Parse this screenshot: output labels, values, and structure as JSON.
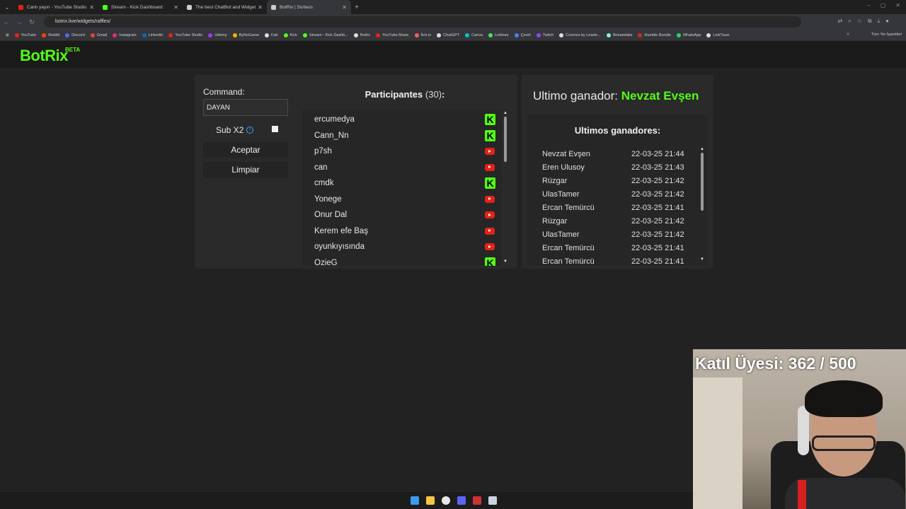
{
  "browser": {
    "tabs": [
      {
        "title": "Canlı yayın - YouTube Studio",
        "color": "#e62117"
      },
      {
        "title": "Stream - Kick Dashboard",
        "color": "#53fc18"
      },
      {
        "title": "The best ChatBot and Widgets",
        "color": "#cccccc"
      },
      {
        "title": "BotRix | Sorteos",
        "color": "#cccccc"
      }
    ],
    "url": "botrix.live/widgets/raffles/",
    "bookmarks": [
      {
        "label": "YouTube",
        "color": "#e62117"
      },
      {
        "label": "Reddit",
        "color": "#ff4500"
      },
      {
        "label": "Discord",
        "color": "#5865f2"
      },
      {
        "label": "Gmail",
        "color": "#ea4335"
      },
      {
        "label": "Instagram",
        "color": "#e1306c"
      },
      {
        "label": "LinkedIn",
        "color": "#0a66c2"
      },
      {
        "label": "YouTube Studio",
        "color": "#e62117"
      },
      {
        "label": "Udemy",
        "color": "#a435f0"
      },
      {
        "label": "ByNoGame",
        "color": "#f5b400"
      },
      {
        "label": "Fab",
        "color": "#dddddd"
      },
      {
        "label": "Kick",
        "color": "#53fc18"
      },
      {
        "label": "Stream - Kick Dashb...",
        "color": "#53fc18"
      },
      {
        "label": "Botrix",
        "color": "#dddddd"
      },
      {
        "label": "YouTube Music",
        "color": "#e62117"
      },
      {
        "label": "İtch.io",
        "color": "#fa5c5c"
      },
      {
        "label": "ChatGPT",
        "color": "#dddddd"
      },
      {
        "label": "Canva",
        "color": "#00c4cc"
      },
      {
        "label": "Linktree",
        "color": "#43e660"
      },
      {
        "label": "Çeviri",
        "color": "#4285f4"
      },
      {
        "label": "Twitch",
        "color": "#9146ff"
      },
      {
        "label": "Cosmos by Learte...",
        "color": "#dddddd"
      },
      {
        "label": "Streamlabs",
        "color": "#80f5d2"
      },
      {
        "label": "Humble Bundle",
        "color": "#cc2929"
      },
      {
        "label": "WhatsApp",
        "color": "#25d366"
      },
      {
        "label": "LinkTwun",
        "color": "#dddddd"
      }
    ],
    "all_bookmarks": "Tüm Yer İşaretleri"
  },
  "app": {
    "logo": "BotRix",
    "beta": "BETA"
  },
  "raffle": {
    "command_label": "Command:",
    "command_value": "DAYAN",
    "sub_label": "Sub X2",
    "accept": "Aceptar",
    "clear": "Limpiar",
    "participants_title": "Participantes",
    "participants_count": "(30)",
    "participants_colon": ":",
    "participants": [
      {
        "name": "ercumedya",
        "platform": "kick"
      },
      {
        "name": "Cann_Nn",
        "platform": "kick"
      },
      {
        "name": "p7sh",
        "platform": "youtube"
      },
      {
        "name": "can",
        "platform": "youtube"
      },
      {
        "name": "cmdk",
        "platform": "kick"
      },
      {
        "name": "Yonege",
        "platform": "youtube"
      },
      {
        "name": "Onur Dal",
        "platform": "youtube"
      },
      {
        "name": "Kerem efe Baş",
        "platform": "youtube"
      },
      {
        "name": "oyunkıyısında",
        "platform": "youtube"
      },
      {
        "name": "OzieG",
        "platform": "kick"
      }
    ],
    "last_winner_label": "Ultimo ganador:",
    "last_winner": "Nevzat Evşen",
    "history_title": "Ultimos ganadores:",
    "history": [
      {
        "name": "Nevzat Evşen",
        "time": "22-03-25 21:44"
      },
      {
        "name": "Eren Ulusoy",
        "time": "22-03-25 21:43"
      },
      {
        "name": "Rüzgar",
        "time": "22-03-25 21:42"
      },
      {
        "name": "UlasTamer",
        "time": "22-03-25 21:42"
      },
      {
        "name": "Ercan Temürcü",
        "time": "22-03-25 21:41"
      },
      {
        "name": "Rüzgar",
        "time": "22-03-25 21:42"
      },
      {
        "name": "UlasTamer",
        "time": "22-03-25 21:42"
      },
      {
        "name": "Ercan Temürcü",
        "time": "22-03-25 21:41"
      },
      {
        "name": "Ercan Temürcü",
        "time": "22-03-25 21:41"
      }
    ]
  },
  "overlay": {
    "member_text": "Katıl Üyesi: 362 / 500"
  },
  "taskbar": {
    "icons": [
      {
        "name": "windows-start-icon",
        "color": "#3b9bf0"
      },
      {
        "name": "file-explorer-icon",
        "color": "#f5c542"
      },
      {
        "name": "chrome-icon",
        "color": "#e8e8e8"
      },
      {
        "name": "discord-icon",
        "color": "#5865f2"
      },
      {
        "name": "app-icon",
        "color": "#cc3333"
      },
      {
        "name": "steam-icon",
        "color": "#c7d5e0"
      }
    ]
  },
  "colors": {
    "kick_green": "#53fc18",
    "youtube_red": "#e62117"
  }
}
